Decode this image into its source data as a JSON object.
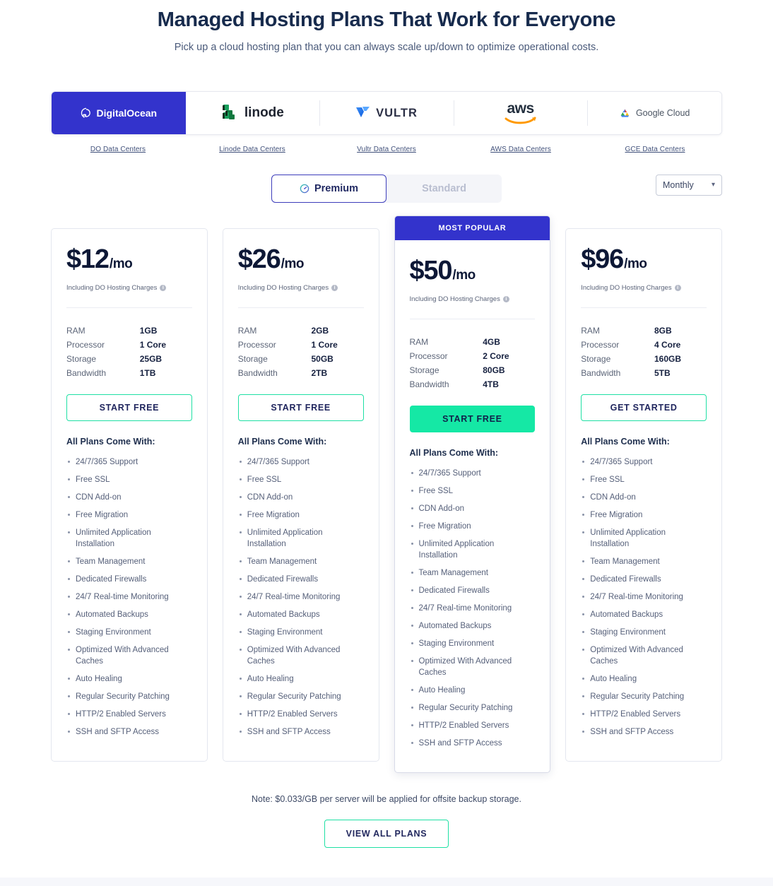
{
  "header": {
    "title": "Managed Hosting Plans That Work for Everyone",
    "subtitle": "Pick up a cloud hosting plan that you can always scale up/down to optimize operational costs."
  },
  "providers": [
    {
      "name": "DigitalOcean",
      "icon": "digitalocean-logo",
      "datacenter_link": "DO Data Centers",
      "active": true
    },
    {
      "name": "linode",
      "icon": "linode-logo",
      "datacenter_link": "Linode Data Centers",
      "active": false
    },
    {
      "name": "VULTR",
      "icon": "vultr-logo",
      "datacenter_link": "Vultr Data Centers",
      "active": false
    },
    {
      "name": "aws",
      "icon": "aws-logo",
      "datacenter_link": "AWS Data Centers",
      "active": false
    },
    {
      "name": "Google Cloud",
      "icon": "google-cloud-logo",
      "datacenter_link": "GCE Data Centers",
      "active": false
    }
  ],
  "controls": {
    "tier_tabs": [
      {
        "label": "Premium",
        "icon": "gauge-icon",
        "active": true
      },
      {
        "label": "Standard",
        "icon": "",
        "active": false
      }
    ],
    "billing_period": {
      "selected": "Monthly",
      "options": [
        "Monthly"
      ],
      "icon": "chevron-down-icon"
    }
  },
  "colors": {
    "brand_blue": "#3333cc",
    "accent_green": "#15e8a5",
    "title_navy": "#172b4d"
  },
  "plans": [
    {
      "price_amount": "$12",
      "price_period": "/mo",
      "charges_note": "Including DO Hosting Charges",
      "specs": [
        {
          "label": "RAM",
          "value": "1GB"
        },
        {
          "label": "Processor",
          "value": "1 Core"
        },
        {
          "label": "Storage",
          "value": "25GB"
        },
        {
          "label": "Bandwidth",
          "value": "1TB"
        }
      ],
      "cta_label": "START FREE",
      "cta_filled": false,
      "badge": "",
      "popular": false
    },
    {
      "price_amount": "$26",
      "price_period": "/mo",
      "charges_note": "Including DO Hosting Charges",
      "specs": [
        {
          "label": "RAM",
          "value": "2GB"
        },
        {
          "label": "Processor",
          "value": "1 Core"
        },
        {
          "label": "Storage",
          "value": "50GB"
        },
        {
          "label": "Bandwidth",
          "value": "2TB"
        }
      ],
      "cta_label": "START FREE",
      "cta_filled": false,
      "badge": "",
      "popular": false
    },
    {
      "price_amount": "$50",
      "price_period": "/mo",
      "charges_note": "Including DO Hosting Charges",
      "specs": [
        {
          "label": "RAM",
          "value": "4GB"
        },
        {
          "label": "Processor",
          "value": "2 Core"
        },
        {
          "label": "Storage",
          "value": "80GB"
        },
        {
          "label": "Bandwidth",
          "value": "4TB"
        }
      ],
      "cta_label": "START FREE",
      "cta_filled": true,
      "badge": "MOST POPULAR",
      "popular": true
    },
    {
      "price_amount": "$96",
      "price_period": "/mo",
      "charges_note": "Including DO Hosting Charges",
      "specs": [
        {
          "label": "RAM",
          "value": "8GB"
        },
        {
          "label": "Processor",
          "value": "4 Core"
        },
        {
          "label": "Storage",
          "value": "160GB"
        },
        {
          "label": "Bandwidth",
          "value": "5TB"
        }
      ],
      "cta_label": "GET STARTED",
      "cta_filled": false,
      "badge": "",
      "popular": false
    }
  ],
  "features": {
    "title": "All Plans Come With:",
    "items": [
      "24/7/365 Support",
      "Free SSL",
      "CDN Add-on",
      "Free Migration",
      "Unlimited Application Installation",
      "Team Management",
      "Dedicated Firewalls",
      "24/7 Real-time Monitoring",
      "Automated Backups",
      "Staging Environment",
      "Optimized With Advanced Caches",
      "Auto Healing",
      "Regular Security Patching",
      "HTTP/2 Enabled Servers",
      "SSH and SFTP Access"
    ]
  },
  "footer": {
    "note": "Note: $0.033/GB per server will be applied for offsite backup storage.",
    "view_all_label": "VIEW ALL PLANS"
  }
}
